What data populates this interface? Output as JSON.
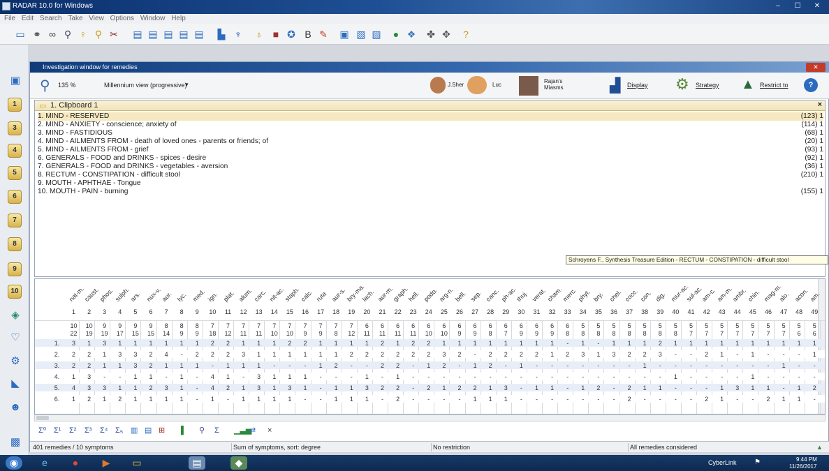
{
  "window": {
    "title": "RADAR 10.0 for Windows",
    "min": "‒",
    "max": "☐",
    "close": "✕"
  },
  "menu": [
    "File",
    "Edit",
    "Search",
    "Take",
    "View",
    "Options",
    "Window",
    "Help"
  ],
  "investigation": {
    "title": "Investigation window for remedies",
    "zoom": "135 %",
    "view_mode": "Millennium view (progressive)",
    "presets": [
      "J.Sher",
      "Luc",
      "Rajan's Miasms"
    ],
    "display_label": "Display",
    "strategy_label": "Strategy",
    "restrict_label": "Restrict to"
  },
  "clipboard": {
    "header": "1. Clipboard 1",
    "rubrics": [
      {
        "text": "1. MIND - RESERVED",
        "count": "(123) 1"
      },
      {
        "text": "2. MIND - ANXIETY - conscience; anxiety of",
        "count": "(114) 1"
      },
      {
        "text": "3. MIND - FASTIDIOUS",
        "count": "(68) 1"
      },
      {
        "text": "4. MIND - AILMENTS FROM - death of loved ones - parents or friends; of",
        "count": "(20) 1"
      },
      {
        "text": "5. MIND - AILMENTS FROM - grief",
        "count": "(93) 1"
      },
      {
        "text": "6. GENERALS - FOOD and DRINKS - spices - desire",
        "count": "(92) 1"
      },
      {
        "text": "7. GENERALS - FOOD and DRINKS - vegetables - aversion",
        "count": "(36) 1"
      },
      {
        "text": "8. RECTUM - CONSTIPATION - difficult stool",
        "count": "(210) 1"
      },
      {
        "text": "9. MOUTH - APHTHAE - Tongue",
        "count": ""
      },
      {
        "text": "10. MOUTH - PAIN - burning",
        "count": "(155) 1"
      }
    ],
    "tooltip": "Schroyens F., Synthesis Treasure Edition - RECTUM - CONSTIPATION - difficult stool"
  },
  "grid": {
    "remedies": [
      "nat-m.",
      "caust.",
      "phos.",
      "sulph.",
      "ars.",
      "nux-v.",
      "aur.",
      "lyc.",
      "med.",
      "ign.",
      "plat.",
      "alum.",
      "carc.",
      "nit-ac.",
      "staph.",
      "calc.",
      "ruta",
      "aur-s.",
      "bry-ma.",
      "lach.",
      "aur-m.",
      "graph.",
      "hell.",
      "podo.",
      "arg-n.",
      "bell.",
      "sep.",
      "canc.",
      "ph-ac.",
      "thuj.",
      "verat.",
      "cham.",
      "merc.",
      "phyt.",
      "bry.",
      "chel.",
      "cocc.",
      "con.",
      "dig.",
      "mur-ac.",
      "sul-ac.",
      "am-c.",
      "am-m.",
      "ambr.",
      "chin.",
      "mag-m.",
      "alo.",
      "acon.",
      "am."
    ],
    "numbers": [
      "1",
      "2",
      "3",
      "4",
      "5",
      "6",
      "7",
      "8",
      "9",
      "10",
      "11",
      "12",
      "13",
      "14",
      "15",
      "16",
      "17",
      "18",
      "19",
      "20",
      "21",
      "22",
      "23",
      "24",
      "25",
      "26",
      "27",
      "28",
      "29",
      "30",
      "31",
      "32",
      "33",
      "34",
      "35",
      "36",
      "37",
      "38",
      "39",
      "40",
      "41",
      "42",
      "43",
      "44",
      "45",
      "46",
      "47",
      "48",
      "49"
    ],
    "totals": [
      "10",
      "10",
      "9",
      "9",
      "9",
      "9",
      "8",
      "8",
      "8",
      "7",
      "7",
      "7",
      "7",
      "7",
      "7",
      "7",
      "7",
      "7",
      "7",
      "6",
      "6",
      "6",
      "6",
      "6",
      "6",
      "6",
      "6",
      "6",
      "6",
      "6",
      "6",
      "6",
      "6",
      "5",
      "5",
      "5",
      "5",
      "5",
      "5",
      "5",
      "5",
      "5",
      "5",
      "5",
      "5",
      "5",
      "5",
      "5",
      "5"
    ],
    "degrees": [
      "22",
      "19",
      "19",
      "17",
      "15",
      "15",
      "14",
      "9",
      "9",
      "18",
      "12",
      "11",
      "11",
      "10",
      "10",
      "9",
      "9",
      "8",
      "12",
      "11",
      "11",
      "11",
      "11",
      "10",
      "10",
      "9",
      "9",
      "8",
      "7",
      "9",
      "9",
      "9",
      "8",
      "8",
      "8",
      "8",
      "8",
      "8",
      "8",
      "8",
      "7",
      "7",
      "7",
      "7",
      "7",
      "7",
      "7",
      "6",
      "6"
    ],
    "rows": [
      {
        "label": "1.",
        "cells": [
          "3",
          "1",
          "3",
          "1",
          "1",
          "1",
          "1",
          "1",
          "1",
          "2",
          "2",
          "1",
          "1",
          "1",
          "2",
          "2",
          "1",
          "1",
          "1",
          "1",
          "2",
          "1",
          "2",
          "2",
          "1",
          "1",
          "1",
          "1",
          "1",
          "1",
          "1",
          "1",
          "-",
          "1",
          "-",
          "1",
          "1",
          "1",
          "2",
          "1",
          "1",
          "1",
          "1",
          "1",
          "1",
          "1",
          "1",
          "1",
          "1"
        ]
      },
      {
        "label": "2.",
        "cells": [
          "2",
          "2",
          "1",
          "3",
          "3",
          "2",
          "4",
          "-",
          "2",
          "2",
          "2",
          "3",
          "1",
          "1",
          "1",
          "1",
          "1",
          "1",
          "2",
          "2",
          "2",
          "2",
          "2",
          "2",
          "3",
          "2",
          "-",
          "2",
          "2",
          "2",
          "2",
          "1",
          "2",
          "3",
          "1",
          "3",
          "2",
          "2",
          "3",
          "-",
          "-",
          "2",
          "1",
          "-",
          "1",
          "-",
          "-",
          "-",
          "1"
        ]
      },
      {
        "label": "3.",
        "cells": [
          "2",
          "2",
          "1",
          "1",
          "3",
          "2",
          "1",
          "1",
          "1",
          "-",
          "1",
          "1",
          "1",
          "-",
          "-",
          "-",
          "1",
          "2",
          "-",
          "-",
          "2",
          "2",
          "-",
          "1",
          "2",
          "-",
          "1",
          "2",
          "-",
          "1",
          "-",
          "-",
          "-",
          "-",
          "-",
          "-",
          "-",
          "1",
          "-",
          "-",
          "-",
          "-",
          "-",
          "-",
          "-",
          "-",
          "1",
          "-",
          "-"
        ]
      },
      {
        "label": "4.",
        "cells": [
          "1",
          "3",
          "-",
          "-",
          "1",
          "1",
          "-",
          "1",
          "-",
          "4",
          "1",
          "-",
          "3",
          "1",
          "1",
          "1",
          "-",
          "-",
          "-",
          "1",
          "-",
          "1",
          "-",
          "-",
          "-",
          "-",
          "-",
          "-",
          "-",
          "-",
          "-",
          "-",
          "-",
          "-",
          "-",
          "-",
          "-",
          "-",
          "-",
          "1",
          "-",
          "-",
          "-",
          "-",
          "1",
          "-",
          "-",
          "-",
          "-"
        ]
      },
      {
        "label": "5.",
        "cells": [
          "4",
          "3",
          "3",
          "1",
          "1",
          "2",
          "3",
          "1",
          "-",
          "4",
          "2",
          "1",
          "3",
          "1",
          "3",
          "1",
          "-",
          "1",
          "1",
          "3",
          "2",
          "2",
          "-",
          "2",
          "1",
          "2",
          "2",
          "1",
          "3",
          "-",
          "1",
          "1",
          "-",
          "1",
          "2",
          "-",
          "2",
          "1",
          "1",
          "-",
          "-",
          "-",
          "1",
          "3",
          "1",
          "1",
          "-",
          "1",
          "2"
        ]
      },
      {
        "label": "6.",
        "cells": [
          "1",
          "2",
          "1",
          "2",
          "1",
          "1",
          "1",
          "1",
          "-",
          "1",
          "-",
          "1",
          "1",
          "1",
          "1",
          "-",
          "-",
          "1",
          "1",
          "1",
          "-",
          "2",
          "-",
          "-",
          "-",
          "-",
          "1",
          "1",
          "1",
          "-",
          "-",
          "-",
          "-",
          "-",
          "-",
          "-",
          "2",
          "-",
          "-",
          "-",
          "-",
          "2",
          "1",
          "-",
          "-",
          "2",
          "1",
          "1",
          "-"
        ]
      }
    ]
  },
  "bottom_icons": [
    "Σ⁰",
    "Σ¹",
    "Σ²",
    "Σ³",
    "Σ⁴",
    "Σ₅",
    "▥",
    "▤",
    "⊞",
    "▌",
    "⚲",
    "Σ",
    "▁▃▅",
    "⇄",
    "×"
  ],
  "status": {
    "left": "401 remedies / 10 symptoms",
    "sort": "Sum of symptoms, sort: degree",
    "restriction": "No restriction",
    "considered": "All remedies considered"
  },
  "taskbar": {
    "tray_app": "CyberLink",
    "time": "9:44 PM",
    "date": "11/26/2017"
  },
  "colors": {
    "titlebar": "#1e4f94",
    "clipboard_header": "#f1e4b6",
    "highlight_row": "#f6e8c0",
    "alt_row": "#e8eef7"
  }
}
